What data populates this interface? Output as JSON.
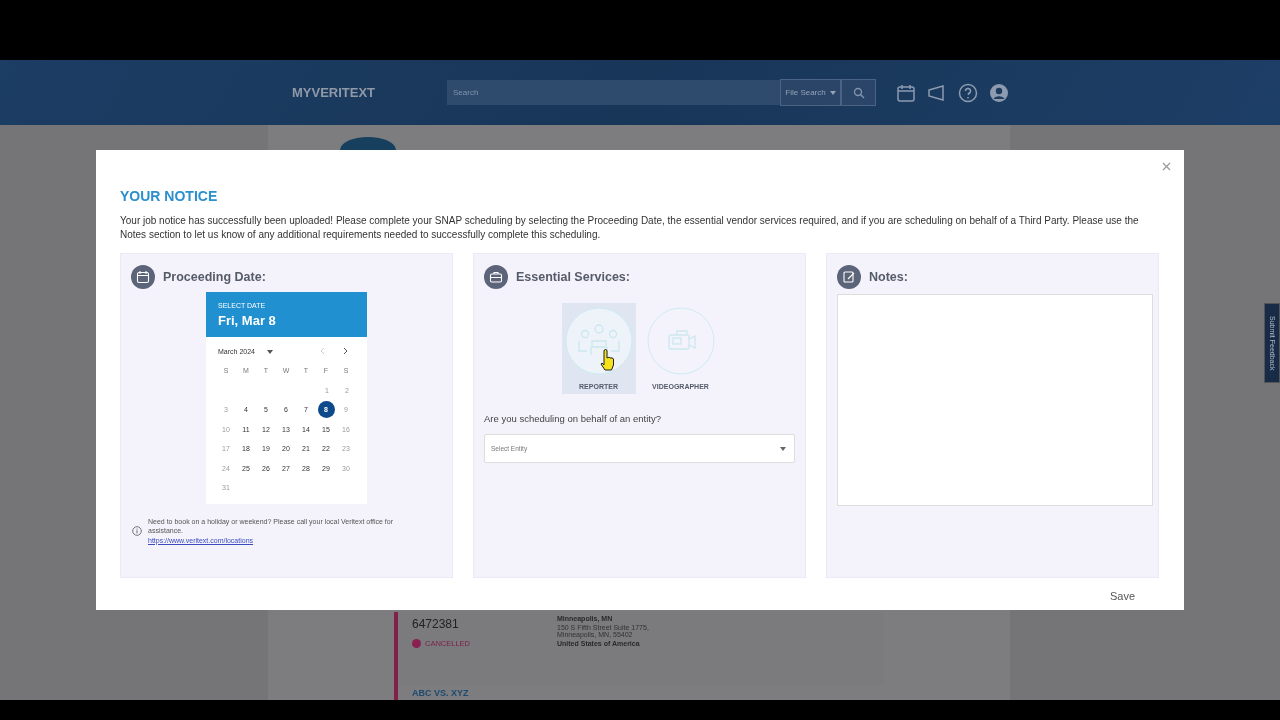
{
  "header": {
    "logo": "MYVERITEXT",
    "search": {
      "placeholder": "Search"
    },
    "search_scope": "File Search"
  },
  "background_card": {
    "number": "6472381",
    "status": "CANCELLED",
    "city": "Minneapolis, MN",
    "address": "150 S Fifth Street Suite 1775, Minneapolis, MN, 55402",
    "country": "United States of America",
    "next_case": "ABC VS. XYZ"
  },
  "feedback_tab": "Submit Feedback",
  "modal": {
    "title": "YOUR NOTICE",
    "message": "Your job notice has successfully been uploaded! Please complete your SNAP scheduling by selecting the Proceeding Date, the essential vendor services required, and if you are scheduling on behalf of a Third Party. Please use the Notes section to let us know of any additional requirements needed to successfully complete this scheduling.",
    "date_panel": {
      "title": "Proceeding Date:",
      "picker": {
        "caption": "SELECT DATE",
        "selected_date": "Fri, Mar 8",
        "month": "March 2024",
        "weekdays": [
          "S",
          "M",
          "T",
          "W",
          "T",
          "F",
          "S"
        ],
        "weeks": [
          [
            {
              "day": "1",
              "disabled": true,
              "selected": false
            },
            {
              "day": "2",
              "disabled": true,
              "selected": false
            }
          ],
          [
            {
              "day": "3",
              "disabled": true,
              "selected": false
            },
            {
              "day": "4",
              "disabled": false,
              "selected": false
            },
            {
              "day": "5",
              "disabled": false,
              "selected": false
            },
            {
              "day": "6",
              "disabled": false,
              "selected": false
            },
            {
              "day": "7",
              "disabled": false,
              "selected": false
            },
            {
              "day": "8",
              "disabled": false,
              "selected": true
            },
            {
              "day": "9",
              "disabled": true,
              "selected": false
            }
          ],
          [
            {
              "day": "10",
              "disabled": true,
              "selected": false
            },
            {
              "day": "11",
              "disabled": false,
              "selected": false
            },
            {
              "day": "12",
              "disabled": false,
              "selected": false
            },
            {
              "day": "13",
              "disabled": false,
              "selected": false
            },
            {
              "day": "14",
              "disabled": false,
              "selected": false
            },
            {
              "day": "15",
              "disabled": false,
              "selected": false
            },
            {
              "day": "16",
              "disabled": true,
              "selected": false
            }
          ],
          [
            {
              "day": "17",
              "disabled": true,
              "selected": false
            },
            {
              "day": "18",
              "disabled": false,
              "selected": false
            },
            {
              "day": "19",
              "disabled": false,
              "selected": false
            },
            {
              "day": "20",
              "disabled": false,
              "selected": false
            },
            {
              "day": "21",
              "disabled": false,
              "selected": false
            },
            {
              "day": "22",
              "disabled": false,
              "selected": false
            },
            {
              "day": "23",
              "disabled": true,
              "selected": false
            }
          ],
          [
            {
              "day": "24",
              "disabled": true,
              "selected": false
            },
            {
              "day": "25",
              "disabled": false,
              "selected": false
            },
            {
              "day": "26",
              "disabled": false,
              "selected": false
            },
            {
              "day": "27",
              "disabled": false,
              "selected": false
            },
            {
              "day": "28",
              "disabled": false,
              "selected": false
            },
            {
              "day": "29",
              "disabled": false,
              "selected": false
            },
            {
              "day": "30",
              "disabled": true,
              "selected": false
            }
          ],
          [
            {
              "day": "31",
              "disabled": true,
              "selected": false
            }
          ]
        ]
      },
      "info": "Need to book on a holiday or weekend? Please call your local Veritext office for assistance.",
      "link": "https://www.veritext.com/locations"
    },
    "services_panel": {
      "title": "Essential Services:",
      "services": [
        {
          "label": "REPORTER",
          "kind": "reporter",
          "selected": true
        },
        {
          "label": "VIDEOGRAPHER",
          "kind": "videographer",
          "selected": false
        }
      ],
      "entity_question": "Are you scheduling on behalf of an entity?",
      "entity_select": {
        "placeholder": "Select Entity"
      }
    },
    "notes_panel": {
      "title": "Notes:"
    },
    "save": "Save"
  }
}
